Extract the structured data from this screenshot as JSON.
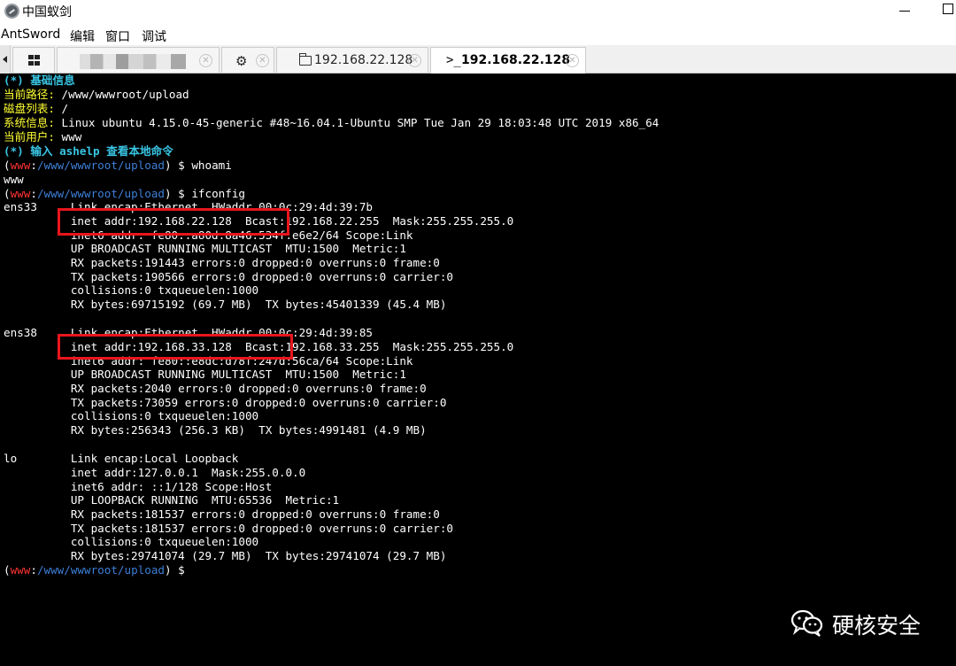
{
  "window": {
    "title": "中国蚁剑"
  },
  "menu": {
    "items": [
      "AntSword",
      "编辑",
      "窗口",
      "调试"
    ]
  },
  "tabs": [
    {
      "label": "",
      "icon": "grid-icon"
    },
    {
      "label": "",
      "icon": "blurred-shell-url"
    },
    {
      "label": "",
      "icon": "gear-icon"
    },
    {
      "label": "192.168.22.128",
      "icon": "folder-icon"
    },
    {
      "label": "192.168.22.128",
      "icon": "terminal-icon",
      "active": true
    }
  ],
  "terminal": {
    "header": "(*) 基础信息",
    "info": [
      {
        "label": "当前路径:",
        "value": " /www/wwwroot/upload"
      },
      {
        "label": "磁盘列表:",
        "value": " /"
      },
      {
        "label": "系统信息:",
        "value": " Linux ubuntu 4.15.0-45-generic #48~16.04.1-Ubuntu SMP Tue Jan 29 18:03:48 UTC 2019 x86_64"
      },
      {
        "label": "当前用户:",
        "value": " www"
      }
    ],
    "hint": "(*) 输入 ashelp 查看本地命令",
    "prompt": {
      "user": "www",
      "path": "/www/wwwroot/upload"
    },
    "commands": [
      {
        "cmd": "$ whoami",
        "output": [
          "www"
        ]
      },
      {
        "cmd": "$ ifconfig",
        "output": [
          "ens33     Link encap:Ethernet  HWaddr 00:0c:29:4d:39:7b",
          "          inet addr:192.168.22.128  Bcast:192.168.22.255  Mask:255.255.255.0",
          "          inet6 addr: fe80::a80d:8a46:534f:e6e2/64 Scope:Link",
          "          UP BROADCAST RUNNING MULTICAST  MTU:1500  Metric:1",
          "          RX packets:191443 errors:0 dropped:0 overruns:0 frame:0",
          "          TX packets:190566 errors:0 dropped:0 overruns:0 carrier:0",
          "          collisions:0 txqueuelen:1000",
          "          RX bytes:69715192 (69.7 MB)  TX bytes:45401339 (45.4 MB)",
          "",
          "ens38     Link encap:Ethernet  HWaddr 00:0c:29:4d:39:85",
          "          inet addr:192.168.33.128  Bcast:192.168.33.255  Mask:255.255.255.0",
          "          inet6 addr: fe80::e8dc:d78f:247d:56ca/64 Scope:Link",
          "          UP BROADCAST RUNNING MULTICAST  MTU:1500  Metric:1",
          "          RX packets:2040 errors:0 dropped:0 overruns:0 frame:0",
          "          TX packets:73059 errors:0 dropped:0 overruns:0 carrier:0",
          "          collisions:0 txqueuelen:1000",
          "          RX bytes:256343 (256.3 KB)  TX bytes:4991481 (4.9 MB)",
          "",
          "lo        Link encap:Local Loopback",
          "          inet addr:127.0.0.1  Mask:255.0.0.0",
          "          inet6 addr: ::1/128 Scope:Host",
          "          UP LOOPBACK RUNNING  MTU:65536  Metric:1",
          "          RX packets:181537 errors:0 dropped:0 overruns:0 frame:0",
          "          TX packets:181537 errors:0 dropped:0 overruns:0 carrier:0",
          "          collisions:0 txqueuelen:1000",
          "          RX bytes:29741074 (29.7 MB)  TX bytes:29741074 (29.7 MB)"
        ]
      },
      {
        "cmd": "$",
        "output": []
      }
    ]
  },
  "watermark": {
    "text": "硬核安全",
    "icon": "wechat-icon"
  },
  "colors": {
    "terminal_bg": "#000000",
    "header": "#39c5e3",
    "label": "#ffff33",
    "prompt_user": "#ff3333",
    "prompt_path": "#3e7fd8",
    "highlight": "#e8161c"
  }
}
